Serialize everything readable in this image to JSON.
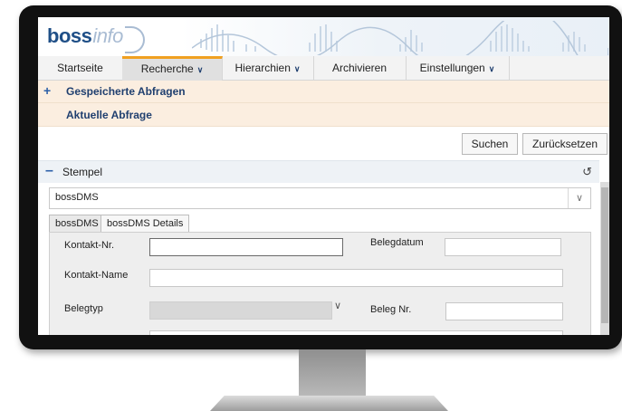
{
  "logo": {
    "brand": "boss",
    "suffix": "info"
  },
  "nav": {
    "items": [
      {
        "label": "Startseite",
        "chevron": false
      },
      {
        "label": "Recherche",
        "chevron": true
      },
      {
        "label": "Hierarchien",
        "chevron": true
      },
      {
        "label": "Archivieren",
        "chevron": false
      },
      {
        "label": "Einstellungen",
        "chevron": true
      }
    ],
    "active_index": 1,
    "accent_color": "#f0a020"
  },
  "queries": {
    "saved_label": "Gespeicherte Abfragen",
    "current_label": "Aktuelle Abfrage"
  },
  "actions": {
    "search_label": "Suchen",
    "reset_label": "Zurücksetzen"
  },
  "stempel": {
    "title": "Stempel",
    "selected_value": "bossDMS",
    "tabs": [
      "bossDMS",
      "bossDMS Details"
    ],
    "fields": {
      "kontakt_nr_label": "Kontakt-Nr.",
      "kontakt_nr_value": "",
      "belegdatum_label": "Belegdatum",
      "belegdatum_value": "",
      "kontakt_name_label": "Kontakt-Name",
      "kontakt_name_value": "",
      "belegtyp_label": "Belegtyp",
      "belegtyp_value": "",
      "beleg_nr_label": "Beleg Nr.",
      "beleg_nr_value": ""
    }
  },
  "icons": {
    "expand": "plus-icon",
    "collapse": "minus-icon",
    "reset": "undo-icon",
    "dropdown": "chevron-down-icon"
  },
  "colors": {
    "brand": "#1f4f87",
    "query_bar": "#fbeee0",
    "link": "#1f3f6f"
  }
}
